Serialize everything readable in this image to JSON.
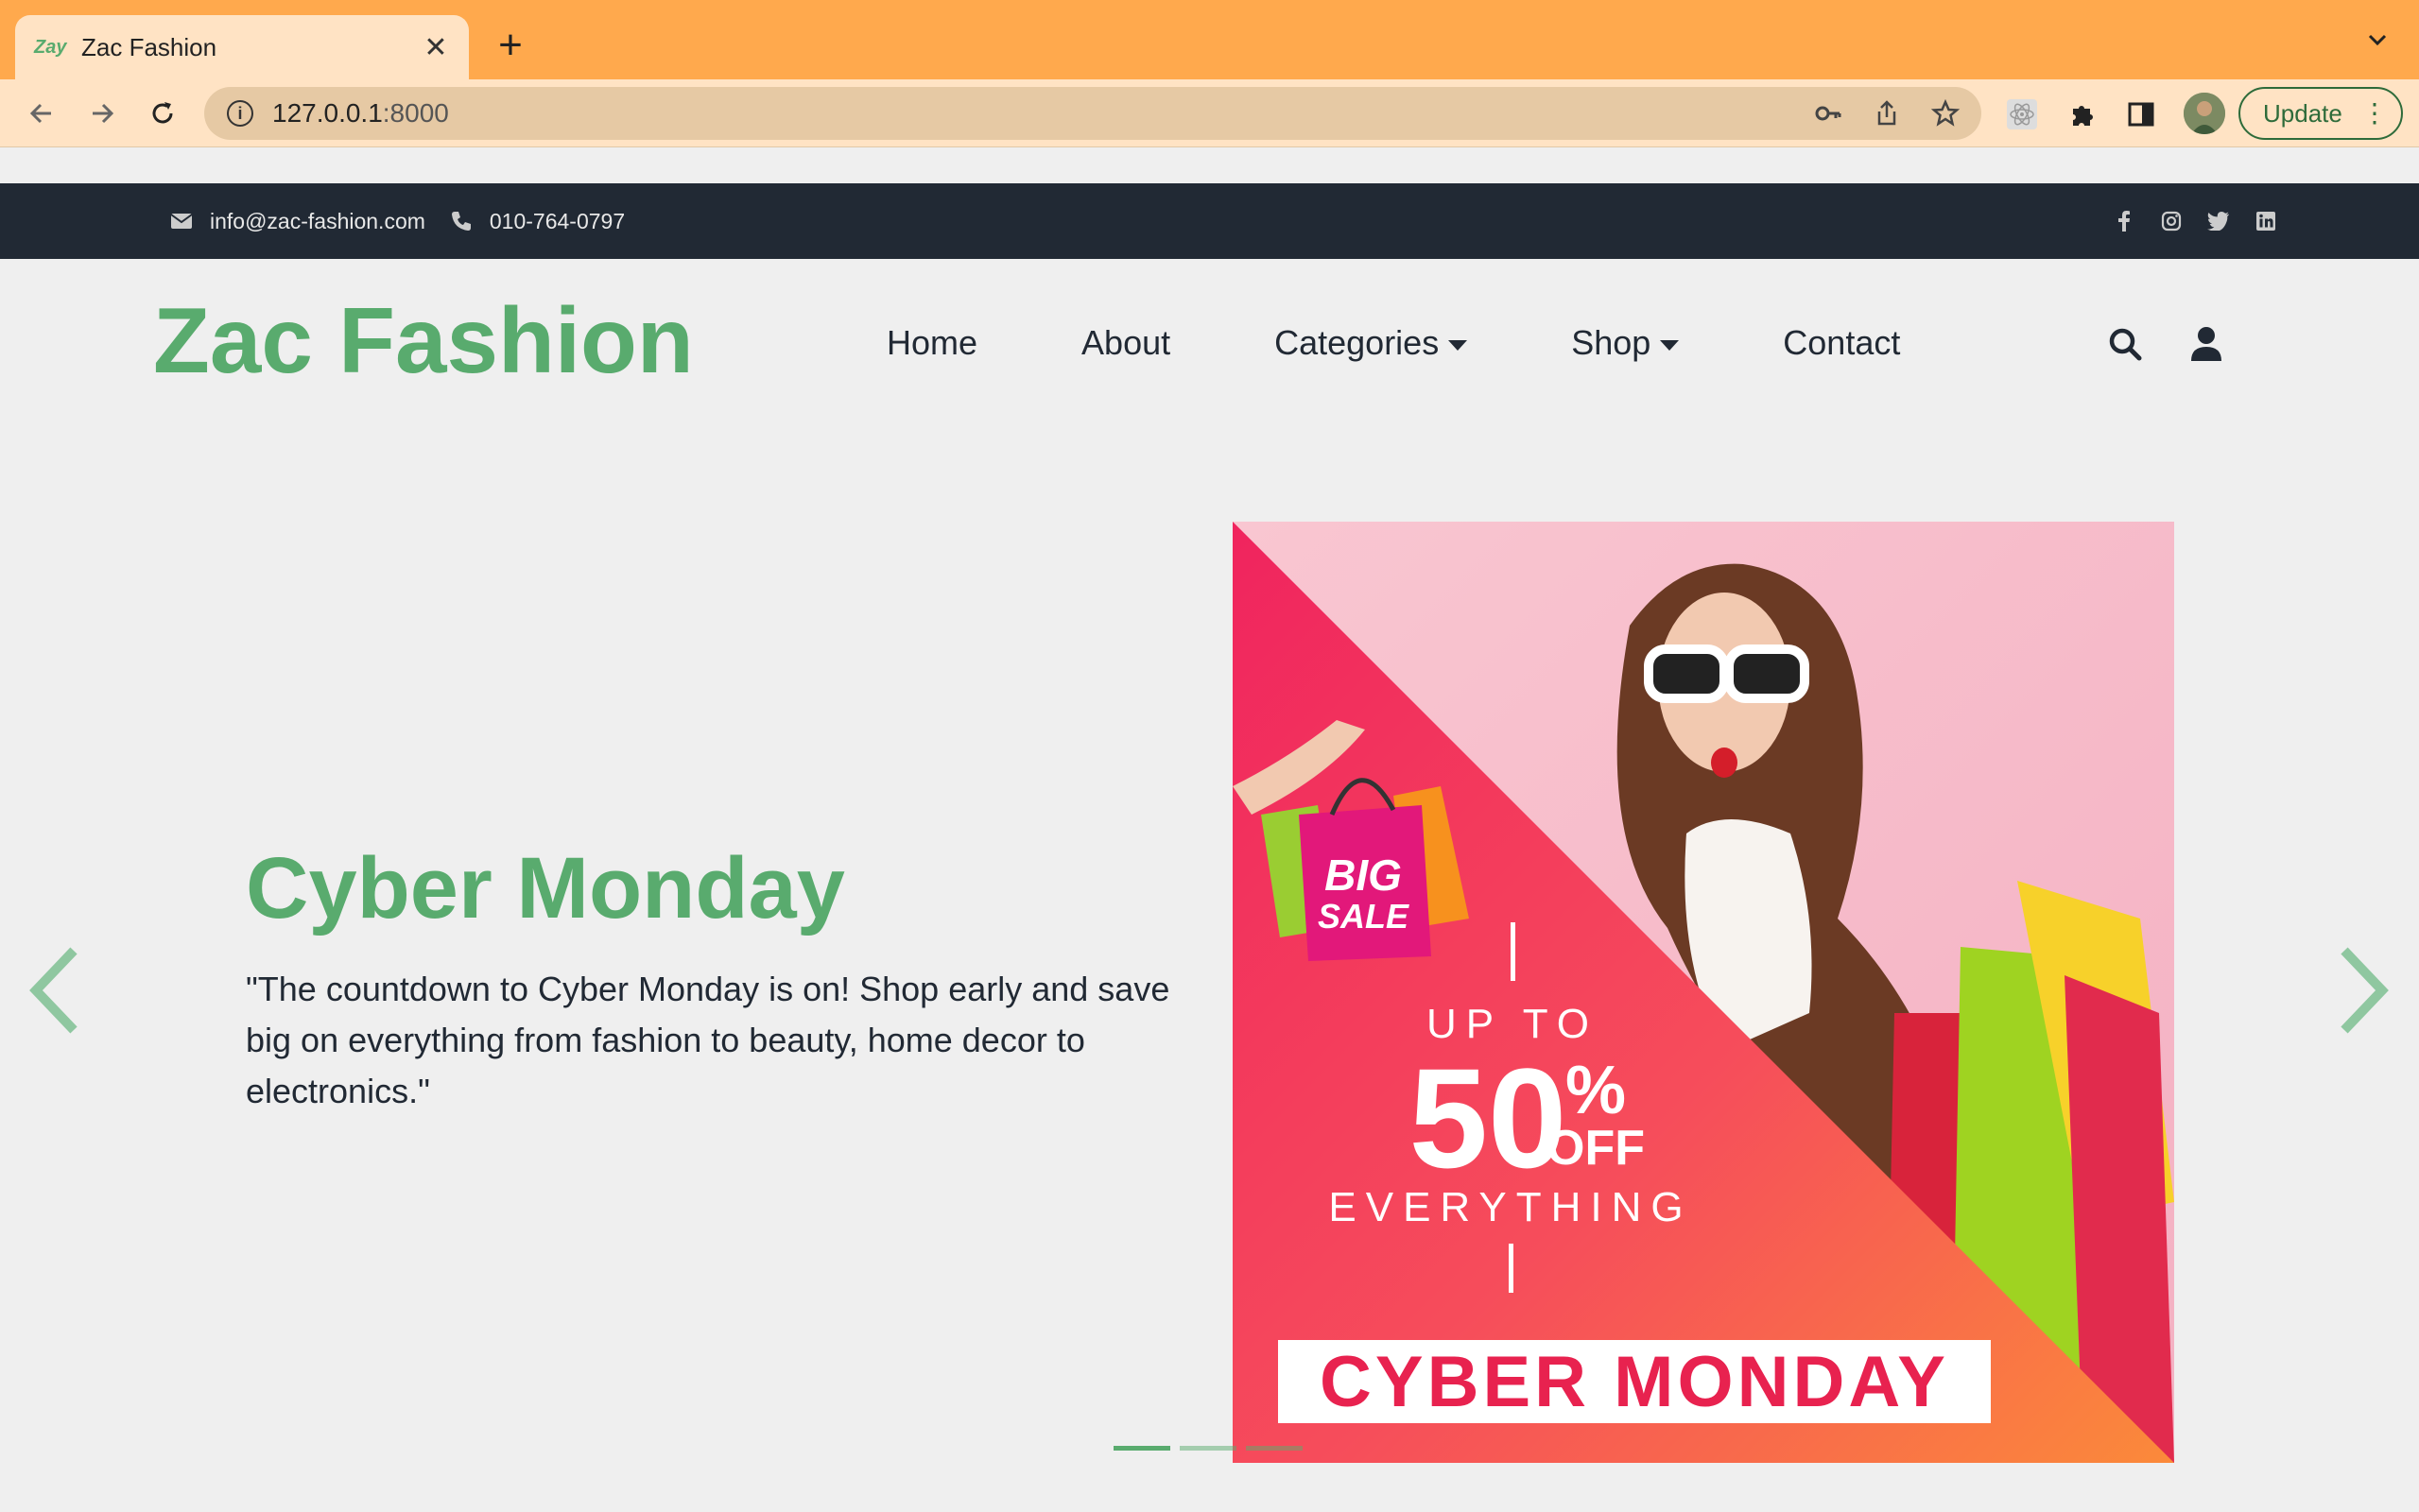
{
  "browser": {
    "tab": {
      "favicon_text": "Zay",
      "title": "Zac Fashion"
    },
    "url_host": "127.0.0.1",
    "url_port": ":8000",
    "update_label": "Update"
  },
  "topbar": {
    "email": "info@zac-fashion.com",
    "phone": "010-764-0797",
    "social": [
      "facebook-icon",
      "instagram-icon",
      "twitter-icon",
      "linkedin-icon"
    ]
  },
  "header": {
    "logo": "Zac Fashion",
    "nav": {
      "home": "Home",
      "about": "About",
      "categories": "Categories",
      "shop": "Shop",
      "contact": "Contact"
    }
  },
  "hero": {
    "title": "Cyber Monday",
    "text": "\"The countdown to Cyber Monday is on! Shop early and save big on everything from fashion to beauty, home decor to electronics.\"",
    "banner": {
      "badge_line1": "BIG",
      "badge_line2": "SALE",
      "up_to": "UP TO",
      "percent": "50",
      "percent_sign": "%",
      "off": "OFF",
      "everything": "EVERYTHING",
      "cta": "CYBER MONDAY"
    },
    "slides_count": 3,
    "active_slide": 1
  },
  "colors": {
    "brand_green": "#59ab6e",
    "topbar_dark": "#212934",
    "chrome_orange": "#ffa94d"
  }
}
